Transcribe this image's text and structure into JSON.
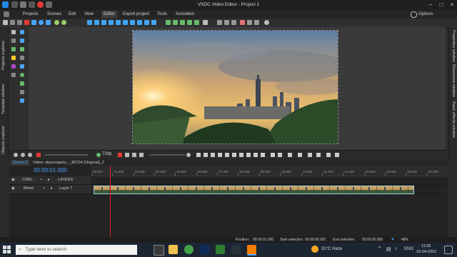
{
  "window": {
    "title": "VSDC Video Editor - Project 1",
    "options_label": "Options"
  },
  "menu": [
    "Projects",
    "Scenes",
    "Edit",
    "View",
    "Editor",
    "Export project",
    "Tools",
    "Activation"
  ],
  "menu_active_index": 4,
  "side_panels": {
    "left": [
      "Projects explorer",
      "Template window",
      "Objects explorer"
    ],
    "right": [
      "Properties window",
      "Resources window",
      "Basic effects window"
    ]
  },
  "transport": {
    "quality": "720p"
  },
  "tabs": [
    "Scene 0",
    "Video: skyscrapers_-_80724 (Original)_2"
  ],
  "timeline": {
    "timecode": "00:00:01.000",
    "ruler_ticks": [
      "00:000",
      "01.200",
      "02.400",
      "03.600",
      "04.800",
      "06.000",
      "07.200",
      "08.400",
      "09.600",
      "10.800",
      "12.000",
      "13.200",
      "14.400",
      "15.600",
      "16.800",
      "18.000",
      "19.200"
    ],
    "tracks": [
      {
        "name": "COM...",
        "label": "LAYERS"
      },
      {
        "name": "Blend",
        "label": "Layer 7"
      }
    ]
  },
  "status": {
    "position_label": "Position:",
    "position_value": "00:00:01.000",
    "start_label": "Start selection:",
    "start_value": "00:00:00.000",
    "end_label": "End selection:",
    "end_value": "00:00:00.000",
    "zoom": "48%"
  },
  "taskbar": {
    "search_placeholder": "Type here to search",
    "weather": "31°C Haze",
    "lang": "ENG",
    "time": "11:05",
    "date": "10-04-2022"
  }
}
